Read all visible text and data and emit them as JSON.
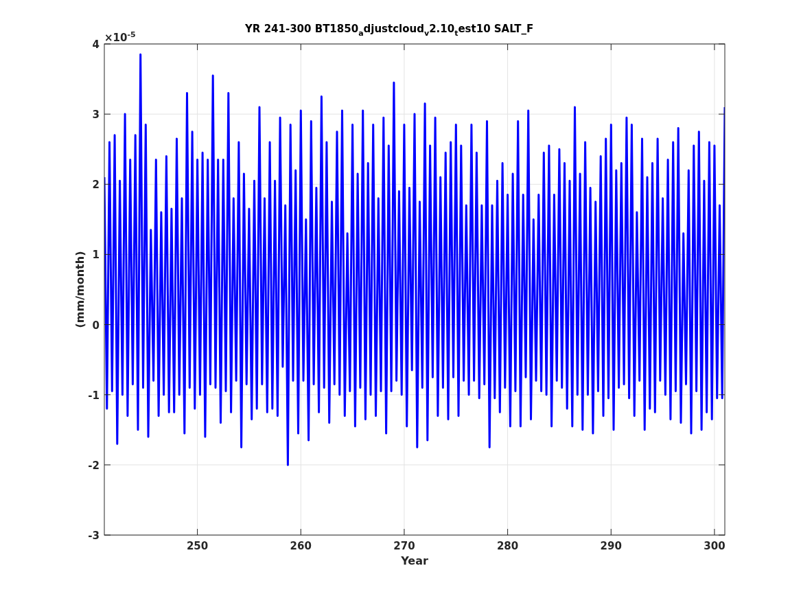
{
  "y_axis_exponent": "×10$^{-5}$",
  "chart_data": {
    "type": "line",
    "title": "YR 241-300 BT1850$_{a}$djustcloud$_{v}$2.10$_{t}$est10 SALT_F",
    "xlabel": "Year",
    "ylabel": "(mm/month)",
    "grid": true,
    "xlim": [
      241,
      301
    ],
    "ylim": [
      -3,
      4
    ],
    "xticks": [
      250,
      260,
      270,
      280,
      290,
      300
    ],
    "yticks": [
      -3,
      -2,
      -1,
      0,
      1,
      2,
      3,
      4
    ],
    "x": [
      241,
      241.25,
      241.5,
      241.75,
      242,
      242.25,
      242.5,
      242.75,
      243,
      243.25,
      243.5,
      243.75,
      244,
      244.25,
      244.5,
      244.75,
      245,
      245.25,
      245.5,
      245.75,
      246,
      246.25,
      246.5,
      246.75,
      247,
      247.25,
      247.5,
      247.75,
      248,
      248.25,
      248.5,
      248.75,
      249,
      249.25,
      249.5,
      249.75,
      250,
      250.25,
      250.5,
      250.75,
      251,
      251.25,
      251.5,
      251.75,
      252,
      252.25,
      252.5,
      252.75,
      253,
      253.25,
      253.5,
      253.75,
      254,
      254.25,
      254.5,
      254.75,
      255,
      255.25,
      255.5,
      255.75,
      256,
      256.25,
      256.5,
      256.75,
      257,
      257.25,
      257.5,
      257.75,
      258,
      258.25,
      258.5,
      258.75,
      259,
      259.25,
      259.5,
      259.75,
      260,
      260.25,
      260.5,
      260.75,
      261,
      261.25,
      261.5,
      261.75,
      262,
      262.25,
      262.5,
      262.75,
      263,
      263.25,
      263.5,
      263.75,
      264,
      264.25,
      264.5,
      264.75,
      265,
      265.25,
      265.5,
      265.75,
      266,
      266.25,
      266.5,
      266.75,
      267,
      267.25,
      267.5,
      267.75,
      268,
      268.25,
      268.5,
      268.75,
      269,
      269.25,
      269.5,
      269.75,
      270,
      270.25,
      270.5,
      270.75,
      271,
      271.25,
      271.5,
      271.75,
      272,
      272.25,
      272.5,
      272.75,
      273,
      273.25,
      273.5,
      273.75,
      274,
      274.25,
      274.5,
      274.75,
      275,
      275.25,
      275.5,
      275.75,
      276,
      276.25,
      276.5,
      276.75,
      277,
      277.25,
      277.5,
      277.75,
      278,
      278.25,
      278.5,
      278.75,
      279,
      279.25,
      279.5,
      279.75,
      280,
      280.25,
      280.5,
      280.75,
      281,
      281.25,
      281.5,
      281.75,
      282,
      282.25,
      282.5,
      282.75,
      283,
      283.25,
      283.5,
      283.75,
      284,
      284.25,
      284.5,
      284.75,
      285,
      285.25,
      285.5,
      285.75,
      286,
      286.25,
      286.5,
      286.75,
      287,
      287.25,
      287.5,
      287.75,
      288,
      288.25,
      288.5,
      288.75,
      289,
      289.25,
      289.5,
      289.75,
      290,
      290.25,
      290.5,
      290.75,
      291,
      291.25,
      291.5,
      291.75,
      292,
      292.25,
      292.5,
      292.75,
      293,
      293.25,
      293.5,
      293.75,
      294,
      294.25,
      294.5,
      294.75,
      295,
      295.25,
      295.5,
      295.75,
      296,
      296.25,
      296.5,
      296.75,
      297,
      297.25,
      297.5,
      297.75,
      298,
      298.25,
      298.5,
      298.75,
      299,
      299.25,
      299.5,
      299.75,
      300,
      300.25,
      300.5,
      300.75,
      301
    ],
    "series": [
      {
        "color": "#0000ff",
        "values": [
          2.1,
          -1.2,
          2.6,
          -0.95,
          2.7,
          -1.7,
          2.05,
          -1.0,
          3.0,
          -1.3,
          2.35,
          -0.85,
          2.7,
          -1.5,
          3.85,
          -0.9,
          2.85,
          -1.6,
          1.35,
          -0.8,
          2.35,
          -1.3,
          1.6,
          -1.0,
          2.4,
          -1.25,
          1.65,
          -1.25,
          2.65,
          -1.0,
          1.8,
          -1.55,
          3.3,
          -0.9,
          2.75,
          -1.2,
          2.35,
          -1.0,
          2.45,
          -1.6,
          2.35,
          -0.85,
          3.55,
          -0.9,
          2.35,
          -1.4,
          2.35,
          -0.95,
          3.3,
          -1.25,
          1.8,
          -0.8,
          2.6,
          -1.75,
          2.15,
          -0.85,
          1.65,
          -1.35,
          2.05,
          -1.2,
          3.1,
          -0.85,
          1.8,
          -1.25,
          2.6,
          -1.2,
          2.05,
          -1.3,
          2.95,
          -0.6,
          1.7,
          -2.0,
          2.85,
          -0.8,
          2.2,
          -1.55,
          3.05,
          -0.8,
          1.5,
          -1.65,
          2.9,
          -0.85,
          1.95,
          -1.25,
          3.25,
          -0.9,
          2.6,
          -1.4,
          1.75,
          -0.85,
          2.75,
          -1.0,
          3.05,
          -1.3,
          1.3,
          -0.95,
          2.85,
          -1.45,
          2.15,
          -0.9,
          3.05,
          -1.35,
          2.3,
          -1.0,
          2.85,
          -1.3,
          1.8,
          -0.95,
          2.95,
          -1.55,
          2.55,
          -0.95,
          3.45,
          -0.8,
          1.9,
          -1.0,
          2.85,
          -1.45,
          1.95,
          -0.65,
          3.0,
          -1.75,
          1.75,
          -0.9,
          3.15,
          -1.65,
          2.55,
          -0.75,
          2.95,
          -1.3,
          2.1,
          -0.9,
          2.45,
          -1.35,
          2.6,
          -0.75,
          2.85,
          -1.3,
          2.55,
          -0.8,
          1.7,
          -1.0,
          2.85,
          -0.8,
          2.45,
          -1.05,
          1.7,
          -0.85,
          2.9,
          -1.75,
          1.7,
          -1.05,
          2.05,
          -1.25,
          2.3,
          -0.9,
          1.85,
          -1.45,
          2.15,
          -0.95,
          2.9,
          -1.45,
          1.85,
          -0.75,
          3.05,
          -1.35,
          1.5,
          -0.8,
          1.85,
          -0.95,
          2.45,
          -1.0,
          2.55,
          -1.45,
          1.85,
          -0.8,
          2.5,
          -0.9,
          2.3,
          -1.2,
          2.05,
          -1.45,
          3.1,
          -1.0,
          2.15,
          -1.5,
          2.6,
          -1.0,
          1.95,
          -1.55,
          1.75,
          -0.95,
          2.4,
          -1.3,
          2.65,
          -1.05,
          2.85,
          -1.5,
          2.2,
          -0.9,
          2.3,
          -0.85,
          2.95,
          -1.05,
          2.85,
          -1.3,
          1.6,
          -0.8,
          2.65,
          -1.5,
          2.1,
          -1.2,
          2.3,
          -1.25,
          2.65,
          -0.8,
          1.8,
          -1.0,
          2.35,
          -1.35,
          2.6,
          -0.95,
          2.8,
          -1.4,
          1.3,
          -0.85,
          2.2,
          -1.55,
          2.55,
          -0.95,
          2.75,
          -1.5,
          2.05,
          -1.25,
          2.6,
          -1.35,
          2.55,
          -1.05,
          1.7,
          -1.05,
          3.1
        ]
      }
    ]
  }
}
